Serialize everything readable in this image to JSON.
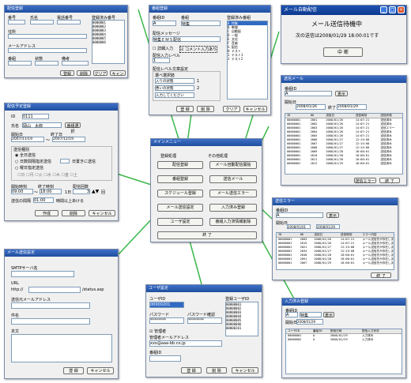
{
  "menu": {
    "title": "メインメニュー",
    "left_heading": "登録処理",
    "right_heading": "その他処理",
    "left_buttons": [
      "配信登録",
      "番組登録",
      "スケジュール登録",
      "メール送信設定",
      "ユーザ設定"
    ],
    "right_buttons": [
      "メール自動配信開始",
      "送信メール",
      "メール送信エラー",
      "入力済み登録",
      "番組入力済情報削除"
    ],
    "exit_label": "終 了"
  },
  "program": {
    "title": "番組登録",
    "id_label": "番組ID",
    "name_label": "番組",
    "id_value": "A",
    "name_value": "特集",
    "message_label": "配信メッセージ",
    "message_value": "特集ＥＭＳ配信",
    "chk_detail": "詳細入力",
    "chk_comment": "コメント入力あり",
    "level_label": "配信入力レベル",
    "level_value": "1",
    "summary_label": "配信レベル文章設定",
    "sub_label": "選べ選択肢",
    "rows": [
      [
        "入りの状態",
        "1"
      ],
      [
        "悪いの状態",
        "2"
      ],
      [
        "入力してください",
        ""
      ]
    ],
    "list_header": "登録済み番組",
    "list_items": [
      "A  特集",
      "B  戦場",
      "C  自動配",
      "D  一般",
      "E  文化",
      "F  音楽",
      "G  配信",
      "H  テスト",
      "I  テスト1",
      "J  テスト2"
    ],
    "btn_register": "登 録",
    "btn_delete": "削 除",
    "btn_clear": "クリア",
    "btn_cancel": "キャンセル"
  },
  "autosend": {
    "title": "メール自動配信",
    "status": "メール送信待機中",
    "next": "次の送信は2008/01/29 18:00:01です",
    "stop": "中 断"
  },
  "sentmail": {
    "title": "送信メール",
    "program_label": "番組ID",
    "program_value": "A",
    "show_btn": "表示",
    "period_label": "開始日",
    "from": "2008/01/26",
    "end_label": "終了",
    "to": "2008/01/29",
    "columns": [
      "ID",
      "NO",
      "送信日",
      "送信時刻",
      "送信状態"
    ],
    "rows": [
      [
        "00000001",
        "2001",
        "2008/01/26",
        "14:07:21",
        "送信済み"
      ],
      [
        "00000001",
        "2002",
        "2008/01/26",
        "14:07:21",
        "送信済み"
      ],
      [
        "00000001",
        "2003",
        "2008/01/26",
        "14:07:21",
        "送信エラー"
      ],
      [
        "00000001",
        "2004",
        "2008/01/26",
        "14:07:21",
        "送信済み"
      ],
      [
        "00000001",
        "2005",
        "2008/01/26",
        "14:07:21",
        "送信済み"
      ],
      [
        "00000001",
        "2006",
        "2008/01/27",
        "12:15:08",
        "送信済み"
      ],
      [
        "00000001",
        "2007",
        "2008/01/27",
        "12:15:08",
        "送信済み"
      ],
      [
        "00000001",
        "2008",
        "2008/01/27",
        "12:15:08",
        "送信済み"
      ],
      [
        "00000001",
        "2009",
        "2008/01/28",
        "18:00:01",
        "送信済み"
      ],
      [
        "00000001",
        "2010",
        "2008/01/28",
        "18:00:01",
        "送信済み"
      ],
      [
        "00000001",
        "2011",
        "2008/01/28",
        "18:00:01",
        "送信済み"
      ],
      [
        "00000001",
        "2012",
        "2008/01/29",
        "18:00:01",
        "送信済み"
      ]
    ],
    "btn_error": "送信エラー",
    "btn_close": "終 了"
  },
  "error": {
    "title": "送信エラー",
    "program_label": "番組ID",
    "program_value": "A",
    "show_btn": "表示",
    "period_label": "開始日",
    "from": "2008/01/01",
    "to": "2008/01/29",
    "columns": [
      "ID",
      "NO",
      "送信日",
      "送信時刻",
      "エラー内容"
    ],
    "rows": [
      [
        "00000001",
        "2003",
        "2008/01/26",
        "14:07:21",
        "メール送信先が存在しません"
      ],
      [
        "00000001",
        "2015",
        "2008/01/26",
        "14:07:21",
        "メール送信先が存在しません"
      ],
      [
        "00000001",
        "2021",
        "2008/01/27",
        "12:15:08",
        "メール送信先が存在しません"
      ],
      [
        "00000001",
        "2034",
        "2008/01/27",
        "12:15:08",
        "メール送信先が存在しません"
      ],
      [
        "00000001",
        "2040",
        "2008/01/28",
        "18:00:01",
        "メール送信先が存在しません"
      ],
      [
        "00000001",
        "2051",
        "2008/01/28",
        "18:00:01",
        "メール送信先が存在しません"
      ],
      [
        "00000001",
        "2067",
        "2008/01/29",
        "18:00:01",
        "メール送信先が存在しません"
      ]
    ],
    "btn_close": "終 了"
  },
  "entered": {
    "title": "入力済み登録",
    "program_label": "番組ID",
    "program_value": "A",
    "program_name": "特集",
    "show_btn": "表示",
    "date_label": "開始日",
    "date_value": "2008/01/29",
    "columns": [
      "ユーザID",
      "番組ID",
      "配信日時",
      "配信入力状況"
    ],
    "rows": [
      [
        "00000001",
        "A",
        "2008/01/29",
        "入力済み"
      ],
      [
        "00000002",
        "A",
        "2008/01/29",
        "入力済み"
      ]
    ]
  },
  "schedule": {
    "title": "配信予定登録",
    "id_label": "ID",
    "id_value": "0111",
    "name_label": "氏名",
    "name_value": "岡山　太郎",
    "name_btn": "番組選択",
    "start_label": "開始日",
    "end_label": "終了日",
    "start_value": "2007/11/19",
    "end_value": "2007/12/19",
    "type_label": "送信種別",
    "options": [
      "全日送信",
      "日数間隔指定送信",
      "曜日指定送信"
    ],
    "daily_note": "日置きに送信",
    "weekdays": [
      "日",
      "月",
      "火",
      "水",
      "木",
      "金",
      "土"
    ],
    "time_start_label": "開始時刻",
    "time_end_label": "終了時刻",
    "interval_label": "配信回数",
    "time_start": "09:00",
    "time_end": "18:00",
    "interval": "3",
    "interval_unit": "回",
    "gap_label": "送信の間隔",
    "gap_value": "01:00",
    "gap_note": "時間以上あける",
    "btn_create": "作成",
    "btn_delete": "削除",
    "btn_cancel": "キャンセル"
  },
  "mailsetting": {
    "title": "メール送信設定",
    "smtp_label": "SMTPサーバ名",
    "smtp_value": "",
    "url_label": "URL",
    "url_prefix": "http://",
    "url_suffix": "/status.asp",
    "from_label": "送信元メールアドレス",
    "subject_label": "件名",
    "body_label": "本文",
    "btn_save": "登 録",
    "btn_cancel": "キャンセル"
  },
  "user": {
    "title": "ユーザ設定",
    "id_label": "ユーザID",
    "id_value": "00000201",
    "pw_label": "パスワード",
    "pw2_label": "パスワード確認",
    "pw_value": "********",
    "pw2_value": "********",
    "admin_label": "管理者",
    "mail_label": "管理者メールアドレス",
    "mail_value": "xxx@aaa-bb.co.jp",
    "memo_label": "番組ID",
    "list_header": "登録ユーザID",
    "list_items": [
      "00000001",
      "00000002",
      "00000003",
      "00000004",
      "00000005",
      "00000006",
      "00000201"
    ],
    "btn_save": "登 録",
    "btn_delete": "削 除",
    "btn_cancel": "キャンセル"
  },
  "registration": {
    "title": "配信登録",
    "fields": [
      "番号",
      "氏名",
      "電話番号",
      "住所",
      "メールアドレス",
      "番組",
      "状態",
      "備考"
    ],
    "list_header": "登録済み番号",
    "list_items": [
      "0000001",
      "0000002",
      "0000003",
      "0000004",
      "0000005",
      "0000006"
    ],
    "btns": [
      "登録",
      "削除",
      "クリア",
      "キャンセル"
    ]
  },
  "colors": {
    "titlebar": "#1f4f9e",
    "connector": "#3cb84a"
  }
}
